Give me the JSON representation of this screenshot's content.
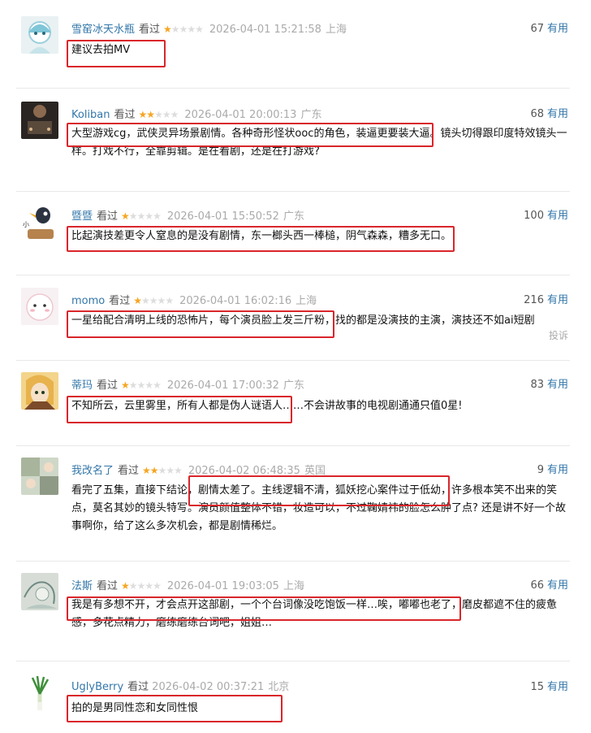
{
  "useful_label": "有用",
  "report_label": "投诉",
  "status_label": "看过",
  "comments": [
    {
      "user": "雪窑冰天水瓶",
      "rating": 1,
      "time": "2026-04-01 15:21:58",
      "location": "上海",
      "useful": "67",
      "text": "建议去拍MV"
    },
    {
      "user": "Koliban",
      "rating": 2,
      "time": "2026-04-01 20:00:13",
      "location": "广东",
      "useful": "68",
      "text": "大型游戏cg，武侠灵异场景剧情。各种奇形怪状ooc的角色，装逼更要装大逼。镜头切得跟印度特效镜头一样。打戏不行，全靠剪辑。是在看剧，还是在打游戏?"
    },
    {
      "user": "暨暨",
      "rating": 1,
      "time": "2026-04-01 15:50:52",
      "location": "广东",
      "useful": "100",
      "text": "比起演技差更令人窒息的是没有剧情，东一榔头西一棒槌，阴气森森，糟多无口。"
    },
    {
      "user": "momo",
      "rating": 1,
      "time": "2026-04-01 16:02:16",
      "location": "上海",
      "useful": "216",
      "text": "一星给配合清明上线的恐怖片，每个演员脸上发三斤粉，找的都是没演技的主演，演技还不如ai短剧"
    },
    {
      "user": "蒂玛",
      "rating": 1,
      "time": "2026-04-01 17:00:32",
      "location": "广东",
      "useful": "83",
      "text": "不知所云，云里雾里，所有人都是伪人谜语人……不会讲故事的电视剧通通只值0星!"
    },
    {
      "user": "我改名了",
      "rating": 2,
      "time": "2026-04-02 06:48:35",
      "location": "英国",
      "useful": "9",
      "text": "看完了五集，直接下结论，剧情太差了。主线逻辑不清，狐妖挖心案件过于低幼，许多根本笑不出来的笑点，莫名其妙的镜头特写。演员颜值整体不错，妆造可以，不过鞠婧祎的脸怎么肿了点? 还是讲不好一个故事啊你，给了这么多次机会，都是剧情稀烂。"
    },
    {
      "user": "法斯",
      "rating": 1,
      "time": "2026-04-01 19:03:05",
      "location": "上海",
      "useful": "66",
      "text": "我是有多想不开，才会点开这部剧，一个个台词像没吃饱饭一样…唉，嘟嘟也老了，磨皮都遮不住的疲惫感，多花点精力，磨练磨练台词吧，姐姐…"
    },
    {
      "user": "UglyBerry",
      "rating": 0,
      "time": "2026-04-02 00:37:21",
      "location": "北京",
      "useful": "15",
      "text": "拍的是男同性恋和女同性恨"
    }
  ],
  "colors": {
    "link": "#3377aa",
    "star": "#f5a623",
    "highlight": "#d9262b"
  }
}
